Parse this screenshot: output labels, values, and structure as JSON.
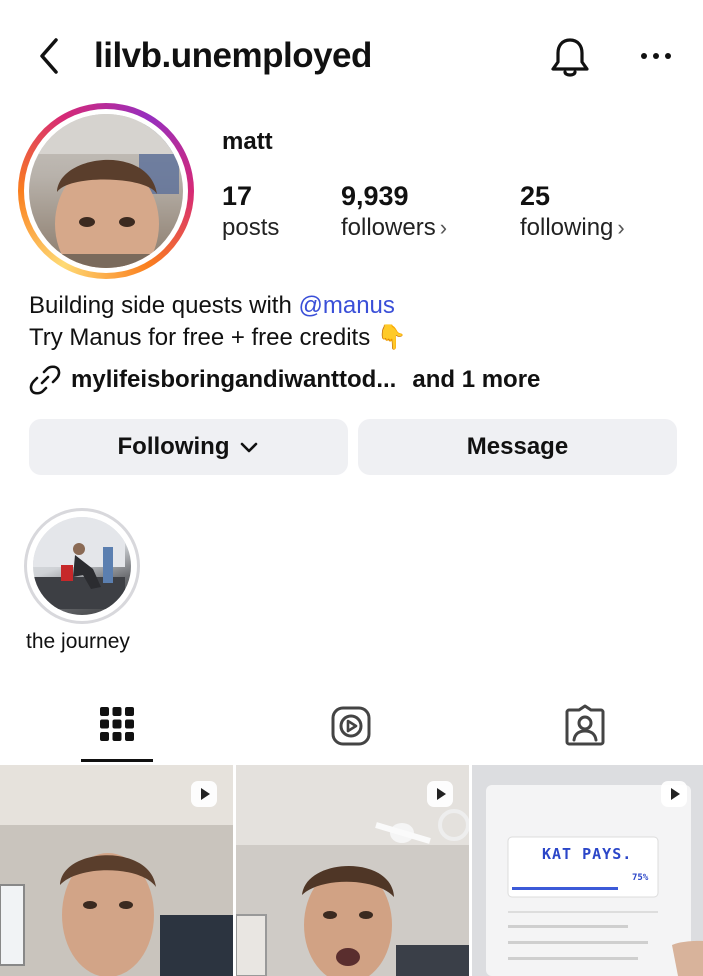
{
  "header": {
    "username": "lilvb.unemployed"
  },
  "profile": {
    "display_name": "matt",
    "stats": [
      {
        "value": "17",
        "label": "posts"
      },
      {
        "value": "9,939",
        "label": "followers"
      },
      {
        "value": "25",
        "label": "following"
      }
    ],
    "bio_line1_prefix": "Building side quests with ",
    "bio_mention": "@manus",
    "bio_line2": "Try Manus for free + free credits",
    "bio_emoji": "👇",
    "link_text": "mylifeisboringandiwanttod...",
    "link_more": "and 1 more"
  },
  "actions": {
    "following_label": "Following",
    "message_label": "Message"
  },
  "highlights": [
    {
      "label": "the journey"
    }
  ],
  "tabs": [
    {
      "icon": "grid-icon",
      "active": true
    },
    {
      "icon": "reels-icon",
      "active": false
    },
    {
      "icon": "tagged-icon",
      "active": false
    }
  ],
  "posts": [
    {
      "type": "reel"
    },
    {
      "type": "reel"
    },
    {
      "type": "reel",
      "headline": "KAT PAYS.",
      "percent": "75%"
    }
  ],
  "colors": {
    "mention": "#3a4fd8",
    "button_bg": "#eff0f3"
  }
}
